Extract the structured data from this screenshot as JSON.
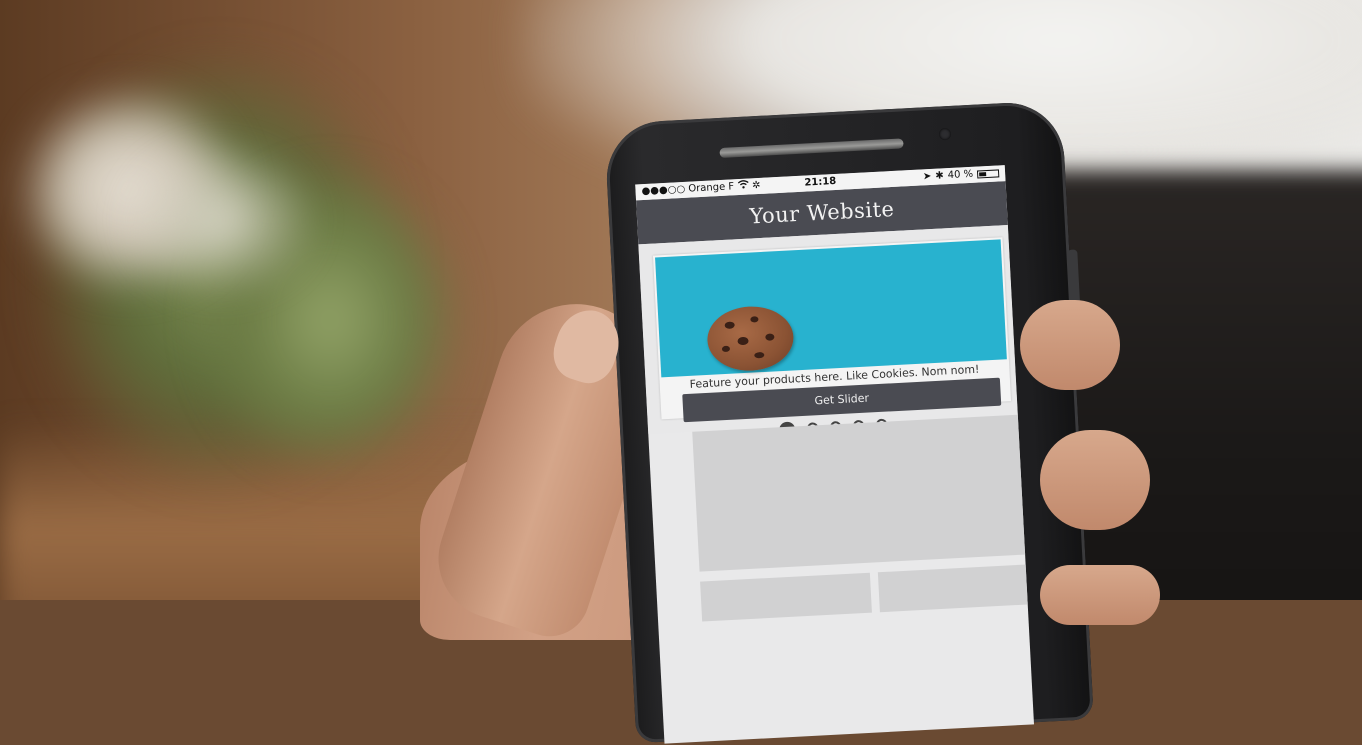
{
  "statusbar": {
    "carrier": "●●●○○ Orange F",
    "time": "21:18",
    "battery": "40 %",
    "battery_level_percent": 40
  },
  "site": {
    "title": "Your Website"
  },
  "slider": {
    "caption": "Feature your products here. Like Cookies. Nom nom!",
    "button_label": "Get Slider",
    "slide_count": 5,
    "active_slide": 1
  },
  "colors": {
    "header_bg": "#4a4b52",
    "slide_1_bg": "#28b2cf",
    "slide_2_bg": "#e0204a",
    "button_bg": "#4a4b52"
  },
  "icons": [
    "wifi-icon",
    "location-arrow-icon",
    "bluetooth-icon",
    "battery-icon",
    "cookie-image"
  ]
}
